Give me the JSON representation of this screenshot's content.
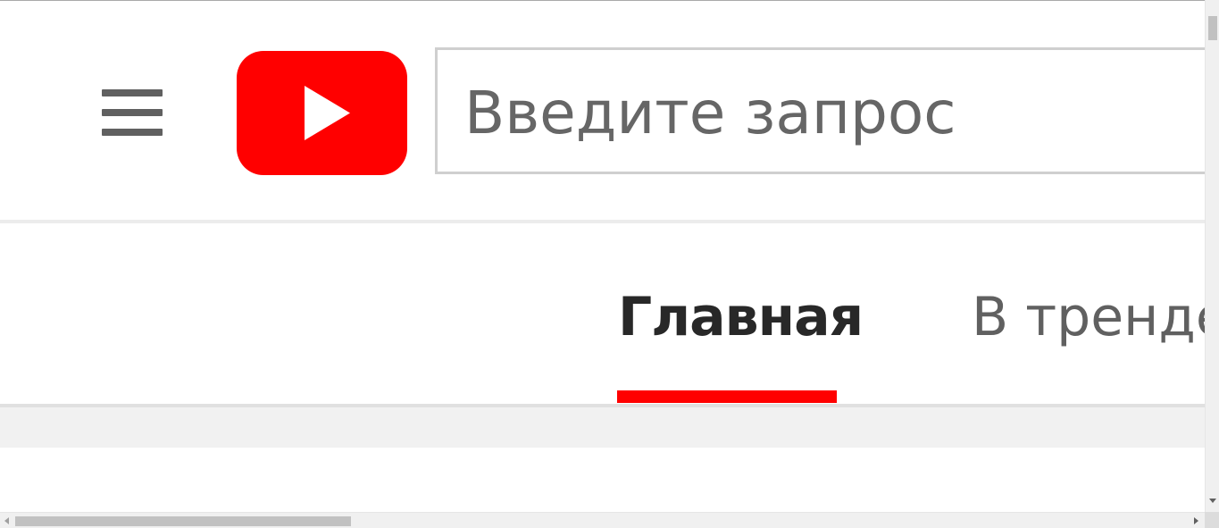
{
  "header": {
    "menu_icon": "hamburger-menu-icon",
    "logo_icon": "youtube-logo-icon",
    "search": {
      "placeholder": "Введите запрос",
      "value": ""
    }
  },
  "tabs": [
    {
      "label": "Главная",
      "active": true
    },
    {
      "label": "В тренде",
      "active": false
    }
  ],
  "colors": {
    "brand_red": "#ff0000",
    "active_tab_text": "#282828",
    "inactive_tab_text": "#606060",
    "icon_gray": "#606060",
    "band_bg": "#f1f1f1"
  }
}
